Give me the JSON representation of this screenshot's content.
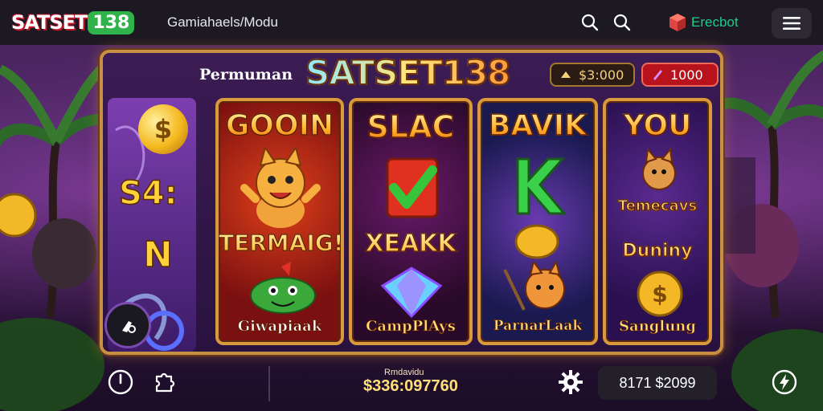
{
  "header": {
    "logo_main": "SATSET",
    "logo_num": "138",
    "site_subtitle": "Gamiahaels/Modu",
    "brand_right": "Erecbot",
    "icons": [
      "search-icon",
      "search-icon-2",
      "cube-icon",
      "menu-icon"
    ]
  },
  "machine": {
    "permainan": "Permuman",
    "title": "SATSET138",
    "coins": "$3:000",
    "gems": "1000"
  },
  "left_column": {
    "coin_symbol": "$",
    "big_text": "S4:",
    "letter": "N"
  },
  "reels": [
    {
      "title": "GOOIN",
      "mid": "TERMAIG!",
      "caption": "Giwapiaak"
    },
    {
      "title": "SLAC",
      "mid": "XEAKK",
      "caption": "CampPlAys"
    },
    {
      "title": "BAVIK",
      "mid": "",
      "caption": "ParnarLaak"
    },
    {
      "title": "YOU",
      "mid": "Temecavs",
      "mid2": "Duniny",
      "caption": "Sanglung"
    }
  ],
  "footer": {
    "label": "Rmdavidu",
    "total": "$336:097760",
    "pill": "8171 $2099",
    "icons": [
      "power-icon",
      "puzzle-icon",
      "gear-icon",
      "lightning-icon"
    ]
  }
}
